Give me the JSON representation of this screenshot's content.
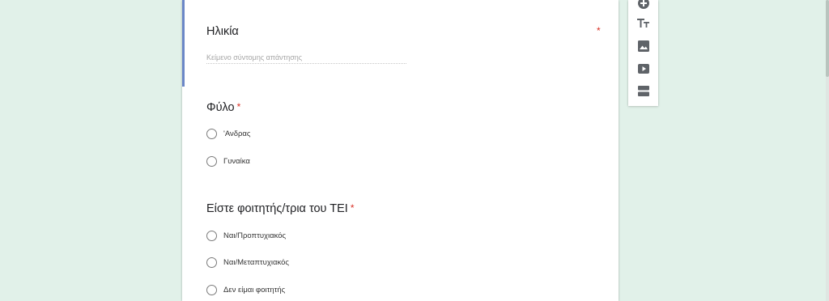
{
  "questions": [
    {
      "title": "Ηλικία",
      "required_mark": "*",
      "answer_placeholder": "Κείμενο σύντομης απάντησης"
    },
    {
      "title": "Φύλο",
      "required_mark": "*",
      "options": [
        "'Ανδρας",
        "Γυναίκα"
      ]
    },
    {
      "title": "Είστε φοιτητής/τρια του ΤΕΙ",
      "required_mark": "*",
      "options": [
        "Ναι/Προπτυχιακός",
        "Ναι/Μεταπτυχιακός",
        "Δεν είμαι φοιτητής"
      ]
    }
  ],
  "toolbar": {
    "tools": [
      "add-question-icon",
      "add-title-icon",
      "add-image-icon",
      "add-video-icon",
      "add-section-icon"
    ]
  },
  "colors": {
    "background": "#e1f1e9",
    "focus_accent": "#6b87c7",
    "required": "#d93025",
    "icon": "#5f6368"
  }
}
